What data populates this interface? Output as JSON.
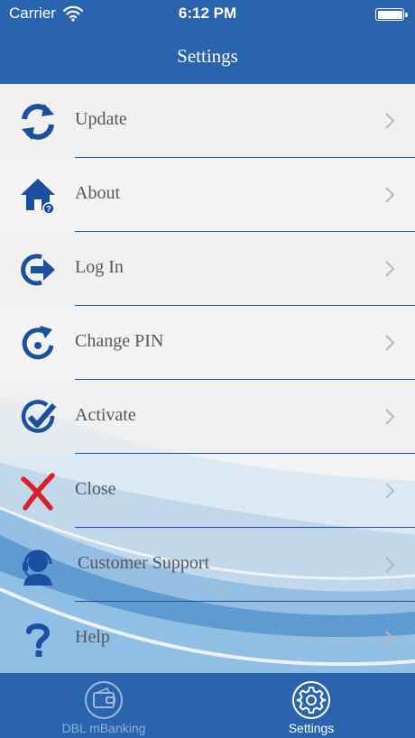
{
  "status_bar": {
    "carrier": "Carrier",
    "time": "6:12 PM"
  },
  "nav": {
    "title": "Settings"
  },
  "menu": [
    {
      "label": "Update",
      "icon": "refresh-icon"
    },
    {
      "label": "About",
      "icon": "home-info-icon"
    },
    {
      "label": "Log In",
      "icon": "login-icon"
    },
    {
      "label": "Change PIN",
      "icon": "change-pin-icon"
    },
    {
      "label": "Activate",
      "icon": "check-circle-icon"
    },
    {
      "label": "Close",
      "icon": "close-x-icon"
    },
    {
      "label": "Customer Support",
      "icon": "headset-icon"
    },
    {
      "label": "Help",
      "icon": "question-icon"
    }
  ],
  "tabs": [
    {
      "label": "DBL mBanking",
      "icon": "wallet-icon",
      "selected": false
    },
    {
      "label": "Settings",
      "icon": "gear-icon",
      "selected": true
    }
  ],
  "colors": {
    "brand_blue": "#2a63ae",
    "icon_blue": "#1b4fa0",
    "close_red": "#d9202a",
    "label_gray": "#55575b"
  }
}
